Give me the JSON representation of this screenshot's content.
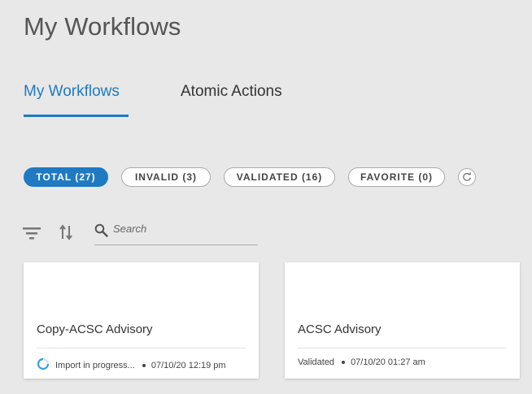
{
  "page": {
    "title": "My Workflows"
  },
  "tabs": [
    {
      "label": "My Workflows",
      "active": true
    },
    {
      "label": "Atomic Actions",
      "active": false
    }
  ],
  "filters": [
    {
      "label": "TOTAL (27)",
      "active": true
    },
    {
      "label": "INVALID (3)",
      "active": false
    },
    {
      "label": "VALIDATED (16)",
      "active": false
    },
    {
      "label": "FAVORITE (0)",
      "active": false
    }
  ],
  "toolbar": {
    "refresh_icon": "refresh-icon",
    "filter_icon": "filter-icon",
    "sort_icon": "sort-icon",
    "search_icon": "search-icon"
  },
  "search": {
    "placeholder": "Search",
    "value": ""
  },
  "cards": [
    {
      "title": "Copy-ACSC Advisory",
      "status": "Import in progress...",
      "timestamp": "07/10/20 12:19 pm",
      "status_icon": "loading-spinner-icon"
    },
    {
      "title": "ACSC Advisory",
      "status": "Validated",
      "timestamp": "07/10/20 01:27 am"
    }
  ],
  "colors": {
    "accent": "#1f7ac2",
    "background": "#e8e8e8",
    "card": "#ffffff"
  }
}
